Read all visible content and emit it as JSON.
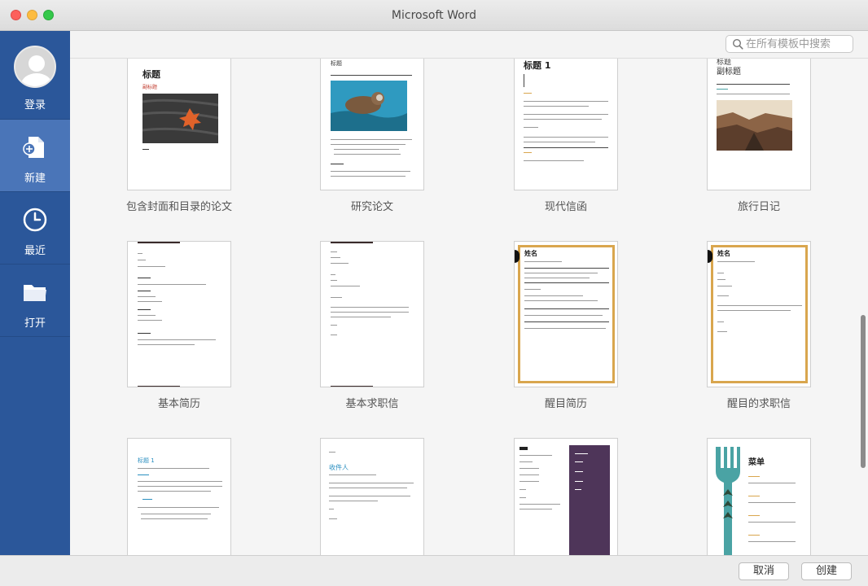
{
  "window": {
    "title": "Microsoft Word"
  },
  "search": {
    "placeholder": "在所有模板中搜索"
  },
  "sidebar": {
    "items": [
      {
        "label": "登录",
        "icon": "avatar"
      },
      {
        "label": "新建",
        "icon": "new-document-icon"
      },
      {
        "label": "最近",
        "icon": "clock-icon"
      },
      {
        "label": "打开",
        "icon": "folder-icon"
      }
    ]
  },
  "templates": [
    {
      "label": "包含封面和目录的论文",
      "title": "标题",
      "subtitle": "副标题"
    },
    {
      "label": "研究论文",
      "title": "标题"
    },
    {
      "label": "现代信函",
      "title": "标题 1"
    },
    {
      "label": "旅行日记",
      "title": "标题",
      "subtitle": "副标题"
    },
    {
      "label": "基本简历"
    },
    {
      "label": "基本求职信"
    },
    {
      "label": "醒目简历",
      "title": "姓名"
    },
    {
      "label": "醒目的求职信",
      "title": "姓名"
    },
    {
      "label": "",
      "title": "标题 1"
    },
    {
      "label": "",
      "title": "收件人"
    },
    {
      "label": ""
    },
    {
      "label": "",
      "title": "菜单"
    }
  ],
  "footer": {
    "cancel_label": "取消",
    "create_label": "创建"
  },
  "colors": {
    "sidebar": "#2b579a",
    "sidebar_active": "#4a75b8",
    "accent_gold": "#d9a64e",
    "accent_teal": "#4aa3a4",
    "accent_purple": "#4e3559"
  }
}
